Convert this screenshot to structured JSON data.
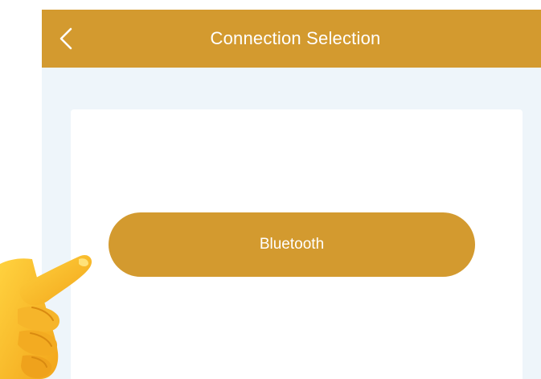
{
  "header": {
    "title": "Connection Selection",
    "back_icon": "chevron-left-icon",
    "color": "#d39a2f"
  },
  "main": {
    "bluetooth_label": "Bluetooth",
    "button_color": "#d39a2f",
    "card_color": "#ffffff",
    "background_color": "#eef5fa"
  },
  "overlay": {
    "pointer_icon": "pointing-hand-icon"
  }
}
